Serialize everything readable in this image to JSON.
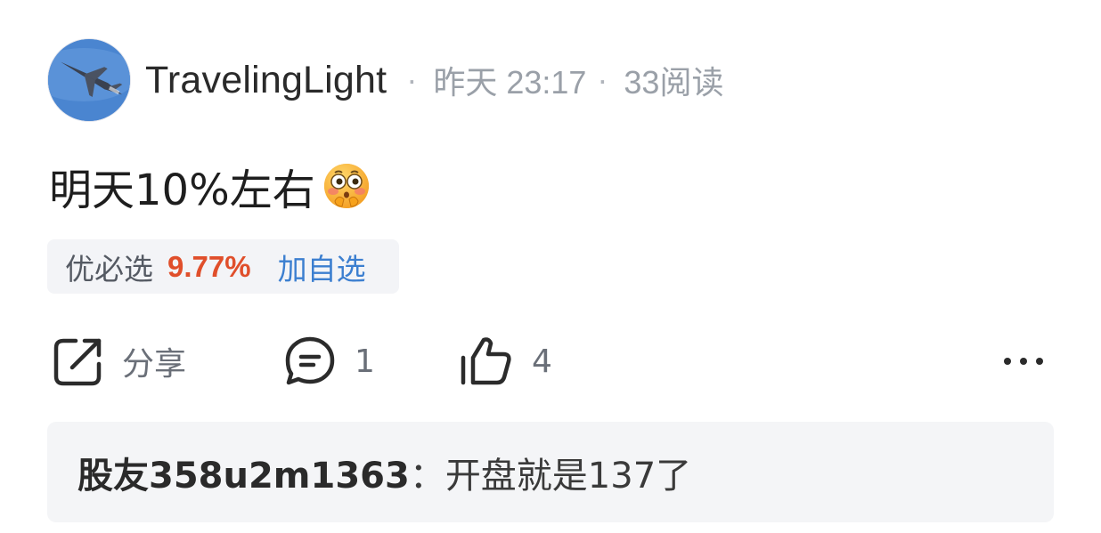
{
  "post": {
    "author": "TravelingLight",
    "separator": "·",
    "time": "昨天 23:17",
    "reads": "33阅读",
    "content": "明天10%左右",
    "emoji": "flushed-face-emoji"
  },
  "stock": {
    "name": "优必选",
    "change": "9.77%",
    "add_label": "加自选",
    "change_color": "#e04f2b",
    "link_color": "#3c7fd0"
  },
  "actions": {
    "share_label": "分享",
    "comment_count": "1",
    "like_count": "4"
  },
  "icons": {
    "share": "share-icon",
    "comment": "comment-icon",
    "like": "thumbs-up-icon",
    "more": "more-icon"
  },
  "comment": {
    "user": "股友358u2m1363",
    "colon": "：",
    "text": "开盘就是137了"
  }
}
